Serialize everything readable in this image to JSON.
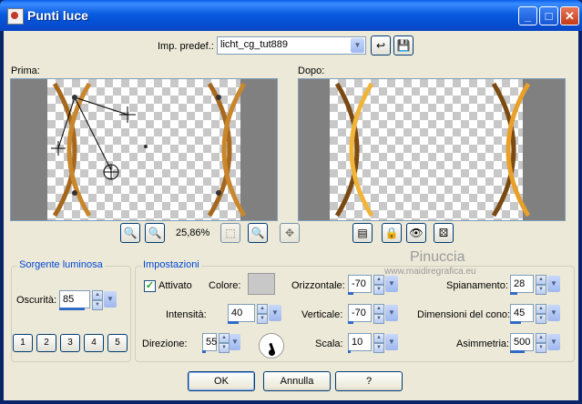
{
  "window": {
    "title": "Punti luce"
  },
  "preset": {
    "label": "Imp. predef.:",
    "value": "licht_cg_tut889"
  },
  "previews": {
    "before_label": "Prima:",
    "after_label": "Dopo:"
  },
  "zoom": {
    "value": "25,86%"
  },
  "watermark": {
    "brand": "Pinuccia",
    "url": "www.maidiregrafica.eu"
  },
  "light_source": {
    "title": "Sorgente luminosa",
    "darkness_label": "Oscurità:",
    "darkness_value": "85",
    "shapes": [
      "1",
      "2",
      "3",
      "4",
      "5"
    ]
  },
  "settings": {
    "title": "Impostazioni",
    "enabled_label": "Attivato",
    "enabled": true,
    "color_label": "Colore:",
    "color": "#c8c8c8",
    "intensity_label": "Intensità:",
    "intensity_value": "40",
    "direction_label": "Direzione:",
    "direction_value": "55",
    "horizontal_label": "Orizzontale:",
    "horizontal_value": "-70",
    "vertical_label": "Verticale:",
    "vertical_value": "-70",
    "scale_label": "Scala:",
    "scale_value": "10",
    "flatten_label": "Spianamento:",
    "flatten_value": "28",
    "cone_label": "Dimensioni del cono:",
    "cone_value": "45",
    "asymmetry_label": "Asimmetria:",
    "asymmetry_value": "500"
  },
  "buttons": {
    "ok": "OK",
    "cancel": "Annulla",
    "help": "?"
  },
  "icons": {
    "title": [
      "app-icon",
      "minimize-icon",
      "maximize-icon",
      "close-icon"
    ],
    "preset": [
      "reset-icon",
      "save-icon"
    ],
    "zoom": [
      "zoom-out-icon",
      "zoom-in-icon",
      "zoom-fit-icon",
      "zoom-actual-icon",
      "pan-icon"
    ],
    "preview_tools": [
      "proof-icon",
      "lock-icon",
      "eye-icon",
      "randomize-icon"
    ]
  }
}
